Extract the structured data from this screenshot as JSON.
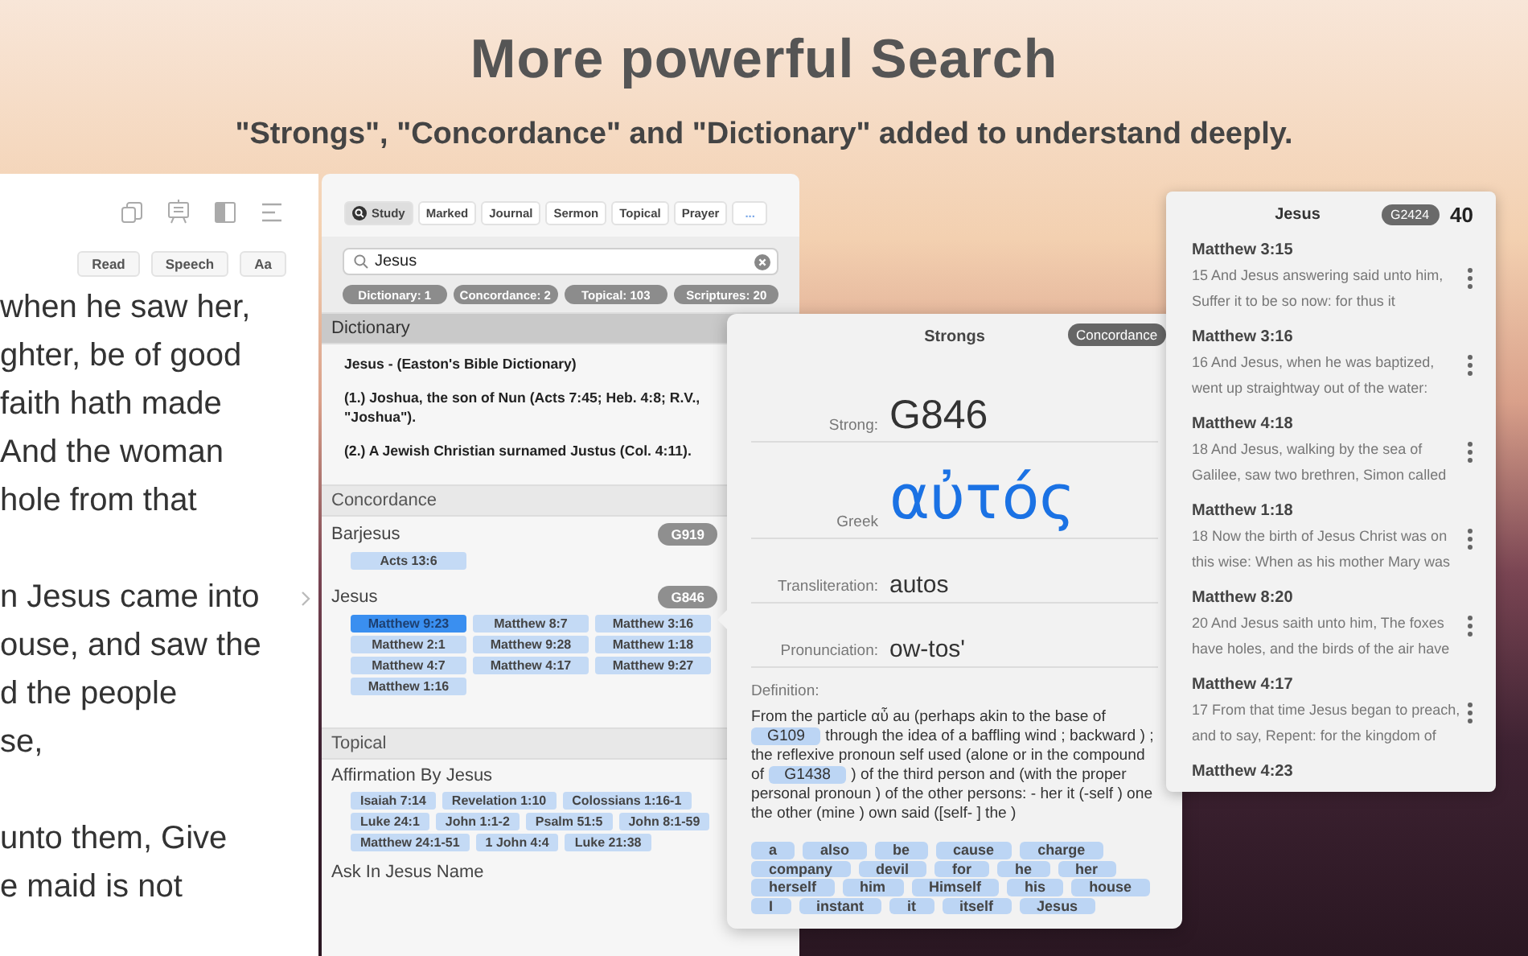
{
  "header": {
    "title": "More powerful Search",
    "subtitle": "\"Strongs\", \"Concordance\" and \"Dictionary\" added to understand deeply."
  },
  "reader": {
    "buttons": [
      "Read",
      "Speech",
      "Aa"
    ],
    "paragraphs": [
      [
        "when he saw her,",
        "ghter, be of good",
        "faith hath made",
        "And the woman",
        "hole from that"
      ],
      [
        "n Jesus came into",
        "ouse, and saw the",
        "d the people",
        "se,"
      ],
      [
        "unto them, Give",
        "e maid is not"
      ]
    ]
  },
  "study": {
    "tabs": [
      {
        "label": "Study",
        "selected": true,
        "kind": "search"
      },
      {
        "label": "Marked",
        "selected": false,
        "kind": "plain"
      },
      {
        "label": "Journal",
        "selected": false,
        "kind": "plain"
      },
      {
        "label": "Sermon",
        "selected": false,
        "kind": "plain"
      },
      {
        "label": "Topical",
        "selected": false,
        "kind": "plain"
      },
      {
        "label": "Prayer",
        "selected": false,
        "kind": "plain"
      },
      {
        "label": "...",
        "selected": false,
        "kind": "more"
      }
    ],
    "search": {
      "value": "Jesus"
    },
    "counts": [
      "Dictionary: 1",
      "Concordance: 2",
      "Topical: 103",
      "Scriptures: 20"
    ],
    "dictionary": {
      "heading": "Dictionary",
      "title": "Jesus - (Easton's Bible Dictionary)",
      "paragraphs": [
        "(1.) Joshua, the son of Nun (Acts 7:45; Heb. 4:8; R.V., \"Joshua\").",
        "(2.) A Jewish Christian surnamed Justus (Col. 4:11)."
      ]
    },
    "concordance": {
      "heading": "Concordance",
      "entries": [
        {
          "word": "Barjesus",
          "code": "G919",
          "refs": [
            {
              "label": "Acts 13:6",
              "selected": false
            }
          ]
        },
        {
          "word": "Jesus",
          "code": "G846",
          "refs": [
            {
              "label": "Matthew 9:23",
              "selected": true
            },
            {
              "label": "Matthew 8:7",
              "selected": false
            },
            {
              "label": "Matthew 3:16",
              "selected": false
            },
            {
              "label": "Matthew 2:1",
              "selected": false
            },
            {
              "label": "Matthew 9:28",
              "selected": false
            },
            {
              "label": "Matthew 1:18",
              "selected": false
            },
            {
              "label": "Matthew 4:7",
              "selected": false
            },
            {
              "label": "Matthew 4:17",
              "selected": false
            },
            {
              "label": "Matthew 9:27",
              "selected": false
            },
            {
              "label": "Matthew 1:16",
              "selected": false
            }
          ]
        }
      ]
    },
    "topical": {
      "heading": "Topical",
      "topics": [
        {
          "title": "Affirmation By Jesus",
          "refs": [
            "Isaiah 7:14",
            "Revelation 1:10",
            "Colossians 1:16-1",
            "Luke 24:1",
            "John 1:1-2",
            "Psalm 51:5",
            "John 8:1-59",
            "Matthew 24:1-51",
            "1 John 4:4",
            "Luke 21:38"
          ]
        },
        {
          "title": "Ask In Jesus Name"
        }
      ]
    }
  },
  "strongs": {
    "title": "Strongs",
    "badge": "Concordance",
    "fields": [
      {
        "kind": "code",
        "label": "Strong:",
        "value": "G846"
      },
      {
        "kind": "greek",
        "label": "Greek",
        "value": "αὐτός"
      },
      {
        "kind": "plain",
        "label": "Transliteration:",
        "value": "autos"
      },
      {
        "kind": "plain",
        "label": "Pronunciation:",
        "value": "ow-tos'"
      }
    ],
    "definition_label": "Definition:",
    "definition": [
      {
        "kind": "text",
        "text": "From the particle αὖ au (perhaps akin to the base of "
      },
      {
        "kind": "ref",
        "text": "G109"
      },
      {
        "kind": "text",
        "text": " through the idea of a baffling wind ; backward ) ;  the reflexive pronoun self used (alone or in the compound of "
      },
      {
        "kind": "ref",
        "text": "G1438"
      },
      {
        "kind": "text",
        "text": " ) of the third person and (with the proper personal pronoun ) of the other persons: - her it (-self ) one the other (mine ) own said ([self- ] the )"
      }
    ],
    "words": [
      "a",
      "also",
      "be",
      "cause",
      "charge",
      "company",
      "devil",
      "for",
      "he",
      "her",
      "herself",
      "him",
      "Himself",
      "his",
      "house",
      "I",
      "instant",
      "it",
      "itself",
      "Jesus"
    ]
  },
  "verses": {
    "title": "Jesus",
    "code": "G2424",
    "count": "40",
    "items": [
      {
        "reference": "Matthew 3:15",
        "text": "15 And Jesus answering said unto him, Suffer it to be so now: for thus it"
      },
      {
        "reference": "Matthew 3:16",
        "text": "16 And Jesus, when he was baptized, went up straightway out of the water:"
      },
      {
        "reference": "Matthew 4:18",
        "text": "18 And Jesus, walking by the sea of Galilee, saw two brethren, Simon called"
      },
      {
        "reference": "Matthew 1:18",
        "text": "18 Now the birth of Jesus Christ was on this wise: When as his mother Mary was"
      },
      {
        "reference": "Matthew 8:20",
        "text": "20 And Jesus saith unto him, The foxes have holes, and the birds of the air have"
      },
      {
        "reference": "Matthew 4:17",
        "text": "17 From that time Jesus began to preach, and to say, Repent: for the kingdom of"
      },
      {
        "reference": "Matthew 4:23"
      }
    ]
  }
}
